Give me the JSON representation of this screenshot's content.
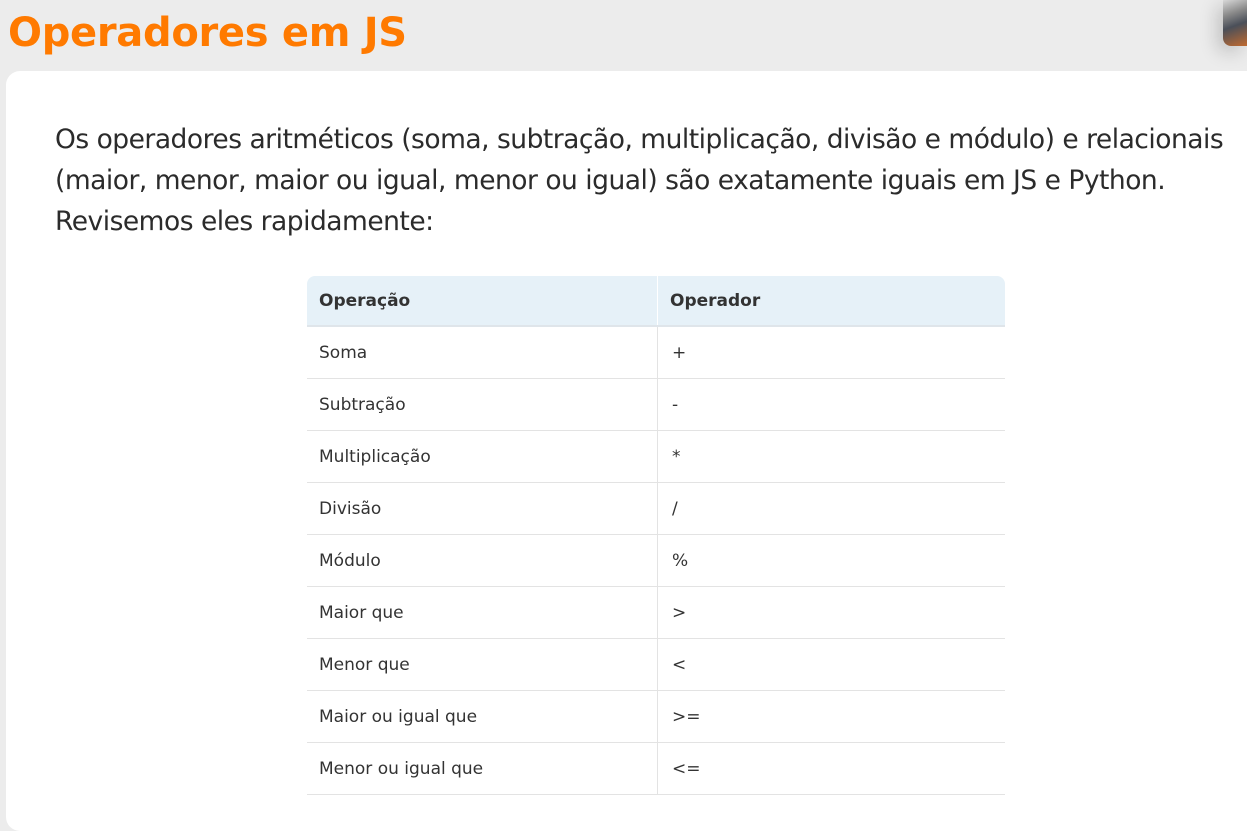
{
  "page": {
    "title": "Operadores em JS",
    "intro": "Os operadores aritméticos (soma, subtração, multiplicação, divisão e módulo) e relacionais (maior, menor, maior ou igual, menor ou igual) são exatamente iguais em JS e Python. Revisemos eles rapidamente:"
  },
  "table": {
    "headers": [
      "Operação",
      "Operador"
    ],
    "rows": [
      {
        "operation": "Soma",
        "operator": "+"
      },
      {
        "operation": "Subtração",
        "operator": "-"
      },
      {
        "operation": "Multiplicação",
        "operator": "*"
      },
      {
        "operation": "Divisão",
        "operator": "/"
      },
      {
        "operation": "Módulo",
        "operator": "%"
      },
      {
        "operation": "Maior que",
        "operator": ">"
      },
      {
        "operation": "Menor que",
        "operator": "<"
      },
      {
        "operation": "Maior ou igual que",
        "operator": ">="
      },
      {
        "operation": "Menor ou igual que",
        "operator": "<="
      }
    ]
  },
  "colors": {
    "title": "#ff7a00",
    "background": "#ececec",
    "card": "#ffffff",
    "table_header": "#e6f1f8"
  }
}
